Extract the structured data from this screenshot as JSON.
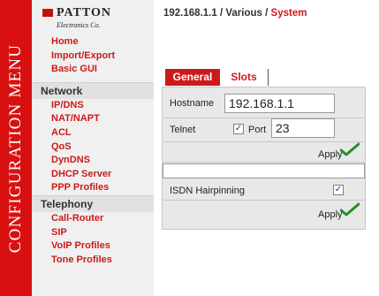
{
  "sidebar": {
    "title": "CONFIGURATION MENU",
    "logo": {
      "brand": "PATTON",
      "sub": "Electronics Co."
    },
    "top_items": [
      "Home",
      "Import/Export",
      "Basic GUI"
    ],
    "sections": [
      {
        "label": "Network",
        "items": [
          "IP/DNS",
          "NAT/NAPT",
          "ACL",
          "QoS",
          "DynDNS",
          "DHCP Server",
          "PPP Profiles"
        ]
      },
      {
        "label": "Telephony",
        "items": [
          "Call-Router",
          "SIP",
          "VoIP Profiles",
          "Tone Profiles"
        ]
      }
    ]
  },
  "breadcrumb": {
    "host": "192.168.1.1",
    "sep1": "/",
    "mid": "Various",
    "sep2": "/",
    "current": "System"
  },
  "tabs": [
    {
      "label": "General",
      "active": true
    },
    {
      "label": "Slots",
      "active": false
    }
  ],
  "form": {
    "hostname_label": "Hostname",
    "hostname_value": "192.168.1.1",
    "telnet_label": "Telnet",
    "telnet_checked": true,
    "port_label": "Port",
    "port_value": "23",
    "apply_label": "Apply",
    "isdn_label": "ISDN Hairpinning",
    "isdn_checked": true,
    "apply2_label": "Apply"
  },
  "colors": {
    "accent": "#cc1a1a",
    "bar": "#d81010",
    "check": "#2a8a2a"
  }
}
